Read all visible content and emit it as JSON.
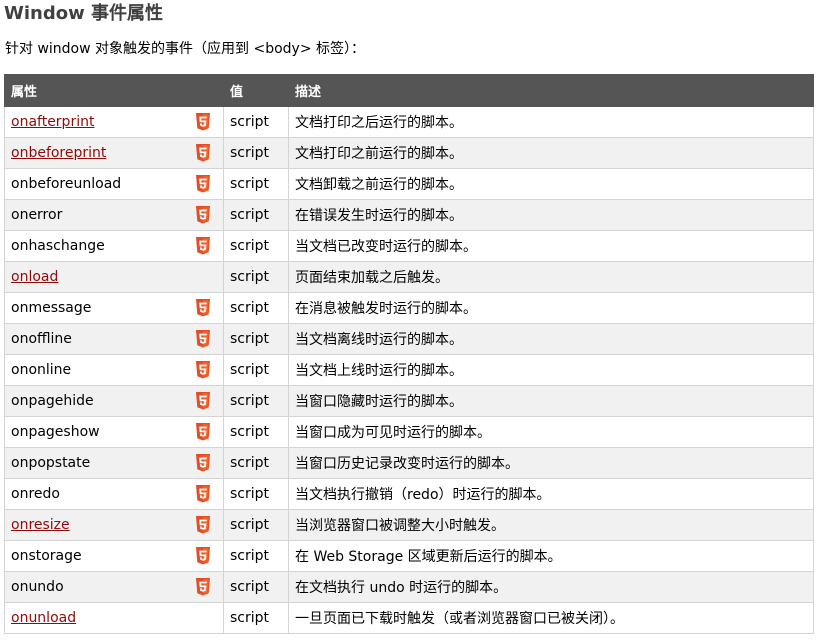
{
  "heading": "Window 事件属性",
  "intro": "针对 window 对象触发的事件（应用到 <body> 标签）：",
  "table": {
    "headers": [
      "属性",
      "值",
      "描述"
    ],
    "rows": [
      {
        "attr": "onafterprint",
        "link": true,
        "html5": true,
        "value": "script",
        "desc": "文档打印之后运行的脚本。"
      },
      {
        "attr": "onbeforeprint",
        "link": true,
        "html5": true,
        "value": "script",
        "desc": "文档打印之前运行的脚本。"
      },
      {
        "attr": "onbeforeunload",
        "link": false,
        "html5": true,
        "value": "script",
        "desc": "文档卸载之前运行的脚本。"
      },
      {
        "attr": "onerror",
        "link": false,
        "html5": true,
        "value": "script",
        "desc": "在错误发生时运行的脚本。"
      },
      {
        "attr": "onhaschange",
        "link": false,
        "html5": true,
        "value": "script",
        "desc": "当文档已改变时运行的脚本。"
      },
      {
        "attr": "onload",
        "link": true,
        "html5": false,
        "value": "script",
        "desc": "页面结束加载之后触发。"
      },
      {
        "attr": "onmessage",
        "link": false,
        "html5": true,
        "value": "script",
        "desc": "在消息被触发时运行的脚本。"
      },
      {
        "attr": "onoffline",
        "link": false,
        "html5": true,
        "value": "script",
        "desc": "当文档离线时运行的脚本。"
      },
      {
        "attr": "ononline",
        "link": false,
        "html5": true,
        "value": "script",
        "desc": "当文档上线时运行的脚本。"
      },
      {
        "attr": "onpagehide",
        "link": false,
        "html5": true,
        "value": "script",
        "desc": "当窗口隐藏时运行的脚本。"
      },
      {
        "attr": "onpageshow",
        "link": false,
        "html5": true,
        "value": "script",
        "desc": "当窗口成为可见时运行的脚本。"
      },
      {
        "attr": "onpopstate",
        "link": false,
        "html5": true,
        "value": "script",
        "desc": "当窗口历史记录改变时运行的脚本。"
      },
      {
        "attr": "onredo",
        "link": false,
        "html5": true,
        "value": "script",
        "desc": "当文档执行撤销（redo）时运行的脚本。"
      },
      {
        "attr": "onresize",
        "link": true,
        "html5": true,
        "value": "script",
        "desc": "当浏览器窗口被调整大小时触发。"
      },
      {
        "attr": "onstorage",
        "link": false,
        "html5": true,
        "value": "script",
        "desc": "在 Web Storage 区域更新后运行的脚本。"
      },
      {
        "attr": "onundo",
        "link": false,
        "html5": true,
        "value": "script",
        "desc": "在文档执行 undo 时运行的脚本。"
      },
      {
        "attr": "onunload",
        "link": true,
        "html5": false,
        "value": "script",
        "desc": "一旦页面已下载时触发（或者浏览器窗口已被关闭）。"
      }
    ]
  },
  "colors": {
    "header_bg": "#555555",
    "link": "#900b09",
    "alt_row": "#f1f1f1",
    "html5_badge": "#e44d26"
  },
  "icons": {
    "html5": "html5-badge-icon"
  }
}
